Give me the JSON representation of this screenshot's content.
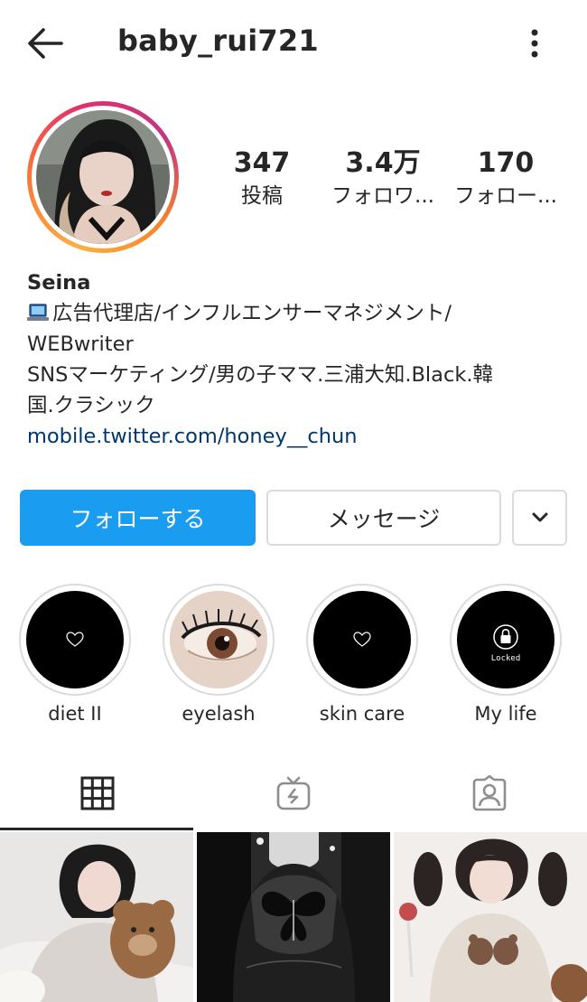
{
  "header": {
    "username": "baby_rui721"
  },
  "stats": [
    {
      "value": "347",
      "label": "投稿"
    },
    {
      "value": "3.4万",
      "label": "フォロワ..."
    },
    {
      "value": "170",
      "label": "フォロー..."
    }
  ],
  "bio": {
    "name": "Seina",
    "line1": "広告代理店/インフルエンサーマネジメント/",
    "line2": "WEBwriter",
    "line3": "SNSマーケティング/男の子ママ.三浦大知.Black.韓",
    "line4": "国.クラシック",
    "link": "mobile.twitter.com/honey__chun",
    "icon": "laptop-icon"
  },
  "actions": {
    "follow_label": "フォローする",
    "message_label": "メッセージ"
  },
  "highlights": [
    {
      "label": "diet II",
      "icon": "heart-icon"
    },
    {
      "label": "eyelash",
      "icon": "eye-photo"
    },
    {
      "label": "skin care",
      "icon": "heart-icon"
    },
    {
      "label": "My life",
      "icon": "lock-icon",
      "badge": "Locked"
    }
  ],
  "tabs": [
    {
      "name": "grid",
      "active": true
    },
    {
      "name": "igtv",
      "active": false
    },
    {
      "name": "tagged",
      "active": false
    }
  ],
  "colors": {
    "accent": "#1a9cf0",
    "link": "#00376b",
    "text": "#262626",
    "border": "#dbdbdb"
  }
}
